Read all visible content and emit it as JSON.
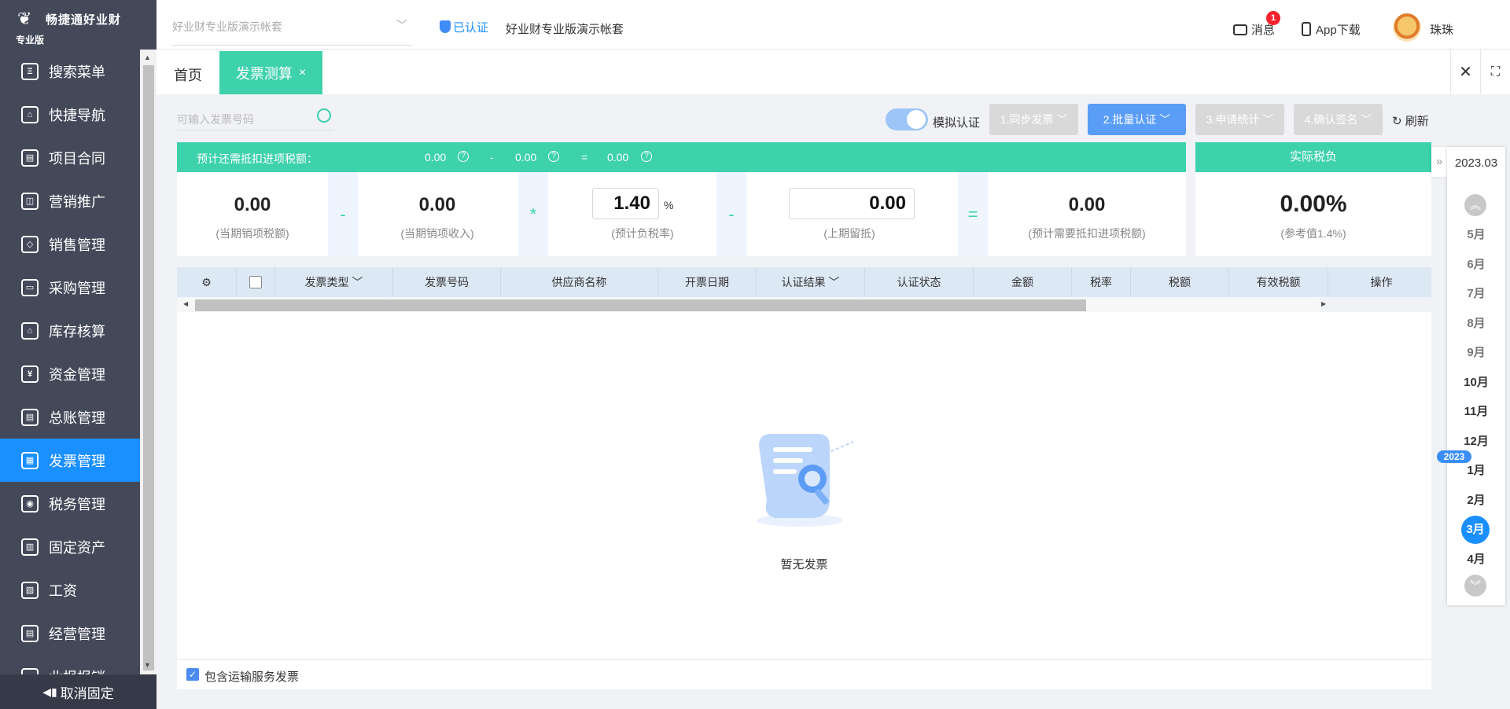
{
  "app": {
    "name": "畅捷通好业财",
    "edition": "专业版"
  },
  "header": {
    "account_select": "好业财专业版演示帐套",
    "verified": "已认证",
    "account_name": "好业财专业版演示帐套",
    "messages": "消息",
    "message_count": "1",
    "app_download": "App下载",
    "user": "珠珠"
  },
  "sidebar": {
    "items": [
      {
        "label": "搜索菜单",
        "icon": "search-menu-icon"
      },
      {
        "label": "快捷导航",
        "icon": "home-icon"
      },
      {
        "label": "项目合同",
        "icon": "contract-icon"
      },
      {
        "label": "营销推广",
        "icon": "gift-icon"
      },
      {
        "label": "销售管理",
        "icon": "sales-icon"
      },
      {
        "label": "采购管理",
        "icon": "briefcase-icon"
      },
      {
        "label": "库存核算",
        "icon": "warehouse-icon"
      },
      {
        "label": "资金管理",
        "icon": "money-bag-icon"
      },
      {
        "label": "总账管理",
        "icon": "ledger-icon"
      },
      {
        "label": "发票管理",
        "icon": "invoice-icon"
      },
      {
        "label": "税务管理",
        "icon": "tax-icon"
      },
      {
        "label": "固定资产",
        "icon": "asset-icon"
      },
      {
        "label": "工资",
        "icon": "salary-icon"
      },
      {
        "label": "经营管理",
        "icon": "clipboard-icon"
      },
      {
        "label": "业报报销",
        "icon": "expense-icon"
      }
    ],
    "active_index": 9,
    "unpin": "取消固定"
  },
  "tabs": {
    "home": "首页",
    "current": "发票测算",
    "close": "×"
  },
  "toolbar": {
    "search_placeholder": "可输入发票号码",
    "simulate": "模拟认证",
    "step1": "1.同步发票",
    "step2": "2.批量认证",
    "step3": "3.申请统计",
    "step4": "4.确认签名",
    "refresh": "刷新"
  },
  "summary": {
    "header_label": "预计还需抵扣进项税额：",
    "h_v1": "0.00",
    "h_minus": "-",
    "h_v2": "0.00",
    "h_eq": "=",
    "h_v3": "0.00",
    "output_tax": "0.00",
    "output_tax_caption": "(当期销项税额)",
    "op1": "-",
    "sales_income": "0.00",
    "sales_income_caption": "(当期销项收入)",
    "op2": "*",
    "tax_rate": "1.40",
    "tax_rate_unit": "%",
    "tax_rate_caption": "(预计负税率)",
    "op3": "-",
    "prev_retained": "0.00",
    "prev_retained_caption": "(上期留抵)",
    "op4": "=",
    "needed": "0.00",
    "needed_caption": "(预计需要抵扣进项税额)",
    "actual_title": "实际税负",
    "actual_value": "0.00%",
    "actual_caption": "(参考值1.4%)"
  },
  "table": {
    "columns": [
      "发票类型",
      "发票号码",
      "供应商名称",
      "开票日期",
      "认证结果",
      "认证状态",
      "金额",
      "税率",
      "税额",
      "有效税额",
      "操作"
    ],
    "empty": "暂无发票",
    "footer_checkbox": "包含运输服务发票"
  },
  "months": {
    "current": "2023.03",
    "year_tag": "2023",
    "list": [
      "5月",
      "6月",
      "7月",
      "8月",
      "9月",
      "10月",
      "11月",
      "12月",
      "1月",
      "2月",
      "3月",
      "4月"
    ],
    "selected_index": 10
  },
  "colors": {
    "accent": "#3dd1ac",
    "primary": "#1a8fff",
    "sidebar": "#44495a"
  }
}
